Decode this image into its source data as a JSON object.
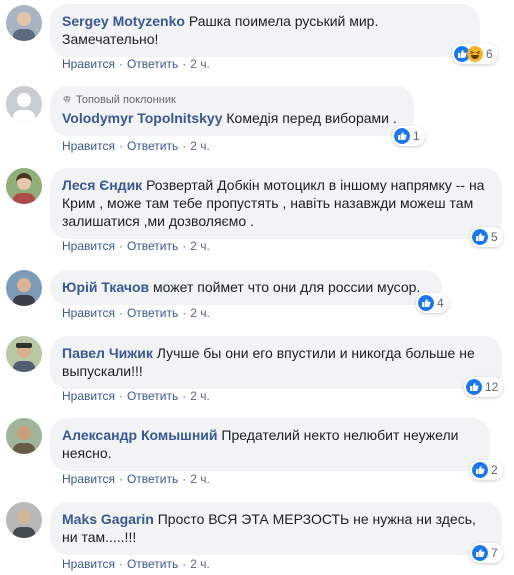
{
  "actions": {
    "like": "Нравится",
    "reply": "Ответить",
    "separator": "·"
  },
  "comments": [
    {
      "author": "Sergey Motyzenko",
      "text": "Рашка поимела руський мир. Замечательно!",
      "time": "2 ч.",
      "reaction_icons": [
        "like-icon",
        "haha-icon"
      ],
      "reaction_count": "6"
    },
    {
      "badge": "Топовый поклонник",
      "author": "Volodymyr Topolnitskyy",
      "text": "Комедія перед виборами .",
      "time": "2 ч.",
      "reaction_icons": [
        "like-icon"
      ],
      "reaction_count": "1"
    },
    {
      "author": "Леся Єндик",
      "text": "Розвертай Добкін мотоцикл в іншому напрямку -- на Крим , може там тебе пропустять , навіть назавжди можеш там залишатися ,ми дозволяємо .",
      "time": "2 ч.",
      "reaction_icons": [
        "like-icon"
      ],
      "reaction_count": "5"
    },
    {
      "author": "Юрій Ткачов",
      "text": "может поймет что они для россии мусор.",
      "time": "2 ч.",
      "reaction_icons": [
        "like-icon"
      ],
      "reaction_count": "4"
    },
    {
      "author": "Павел Чижик",
      "text": "Лучше бы они его впустили и никогда больше не выпускали!!!",
      "time": "2 ч.",
      "reaction_icons": [
        "like-icon"
      ],
      "reaction_count": "12"
    },
    {
      "author": "Александр Комышний",
      "text": "Предателий некто нелюбит неужели неясно.",
      "time": "2 ч.",
      "reaction_icons": [
        "like-icon"
      ],
      "reaction_count": "2"
    },
    {
      "author": "Maks Gagarin",
      "text": "Просто ВСЯ ЭТА МЕРЗОСТЬ не нужна ни здесь, ни там.....!!!",
      "time": "2 ч.",
      "reaction_icons": [
        "like-icon"
      ],
      "reaction_count": "7"
    }
  ],
  "colors": {
    "author": "#385898",
    "bubble": "#f2f3f5",
    "like": "#1877f2",
    "haha": "#f7b125"
  }
}
